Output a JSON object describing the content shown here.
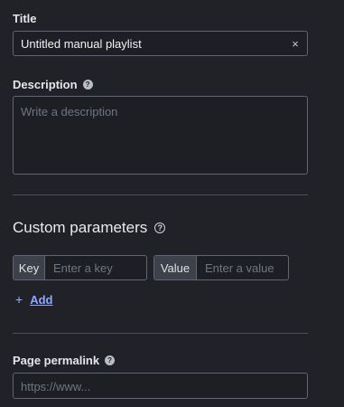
{
  "title_field": {
    "label": "Title",
    "value": "Untitled manual playlist",
    "clear_glyph": "×"
  },
  "description_field": {
    "label": "Description",
    "help_glyph": "?",
    "placeholder": "Write a description"
  },
  "custom_parameters": {
    "heading": "Custom parameters",
    "help_glyph": "?",
    "key_tag": "Key",
    "key_placeholder": "Enter a key",
    "value_tag": "Value",
    "value_placeholder": "Enter a value",
    "add_glyph": "+",
    "add_label": "Add"
  },
  "permalink_field": {
    "label": "Page permalink",
    "help_glyph": "?",
    "placeholder": "https://www..."
  },
  "colors": {
    "background": "#202228",
    "accent_link": "#8ea8ff",
    "border": "#5f6672"
  }
}
